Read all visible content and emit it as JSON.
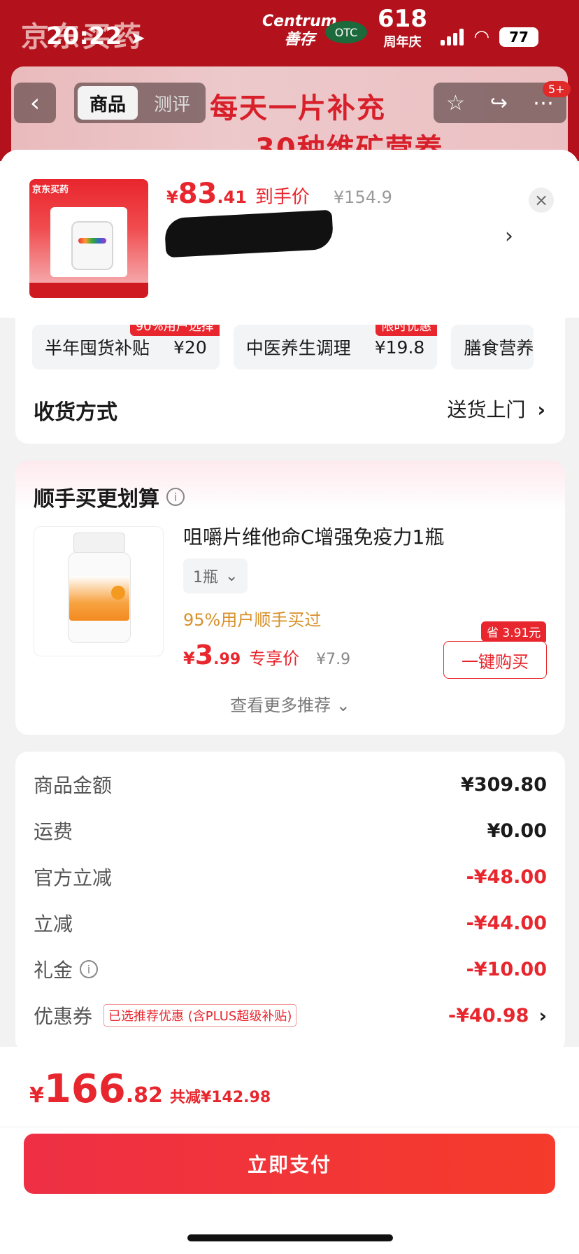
{
  "status_bar": {
    "time": "20:22",
    "battery": "77"
  },
  "banner": {
    "brand": "京东买药",
    "centrum_en": "Centrum",
    "centrum_cn": "善存",
    "otc": "OTC",
    "anniv_num": "618",
    "anniv_text": "周年庆",
    "slogan_line1": "每天一片补充",
    "slogan_line2": "30种维矿营养"
  },
  "nav": {
    "tabs": [
      {
        "label": "商品"
      },
      {
        "label": "测评"
      }
    ],
    "back_icon": "chevron-left-icon",
    "star_icon": "star-icon",
    "share_icon": "share-icon",
    "more_icon": "more-icon",
    "badge": "5+"
  },
  "product": {
    "price_symbol": "¥",
    "price_int": "83",
    "price_dec": ".41",
    "price_tag": "到手价",
    "original_price": "¥154.9"
  },
  "benefits": [
    {
      "name": "半年囤货补贴",
      "amount": "¥20",
      "badge": "90%用户选择"
    },
    {
      "name": "中医养生调理",
      "amount": "¥19.8",
      "badge": "限时优惠"
    },
    {
      "name": "膳食营养",
      "amount": "",
      "badge": ""
    }
  ],
  "delivery": {
    "label": "收货方式",
    "value": "送货上门"
  },
  "recommend": {
    "title": "顺手买更划算",
    "item_name": "咀嚼片维他命C增强免疫力1瓶",
    "spec": "1瓶",
    "sold": "95%用户顺手买过",
    "price_symbol": "¥",
    "price_int": "3",
    "price_dec": ".99",
    "price_tag": "专享价",
    "orig_price": "¥7.9",
    "buy_label": "一键购买",
    "save_badge": "省 3.91元",
    "more": "查看更多推荐"
  },
  "summary": {
    "rows": [
      {
        "label": "商品金额",
        "value": "¥309.80",
        "neg": false
      },
      {
        "label": "运费",
        "value": "¥0.00",
        "neg": false
      },
      {
        "label": "官方立减",
        "value": "-¥48.00",
        "neg": true
      },
      {
        "label": "立减",
        "value": "-¥44.00",
        "neg": true
      },
      {
        "label": "礼金",
        "value": "-¥10.00",
        "neg": true
      },
      {
        "label": "优惠券",
        "value": "-¥40.98",
        "neg": true
      }
    ],
    "coupon_tag": "已选推荐优惠 (含PLUS超级补贴)"
  },
  "footer": {
    "total_symbol": "¥",
    "total_int": "166",
    "total_dec": ".82",
    "saved": "共减¥142.98",
    "pay_label": "立即支付"
  },
  "colors": {
    "accent": "#e8262d",
    "banner": "#b3121c",
    "gold": "#d89029"
  }
}
